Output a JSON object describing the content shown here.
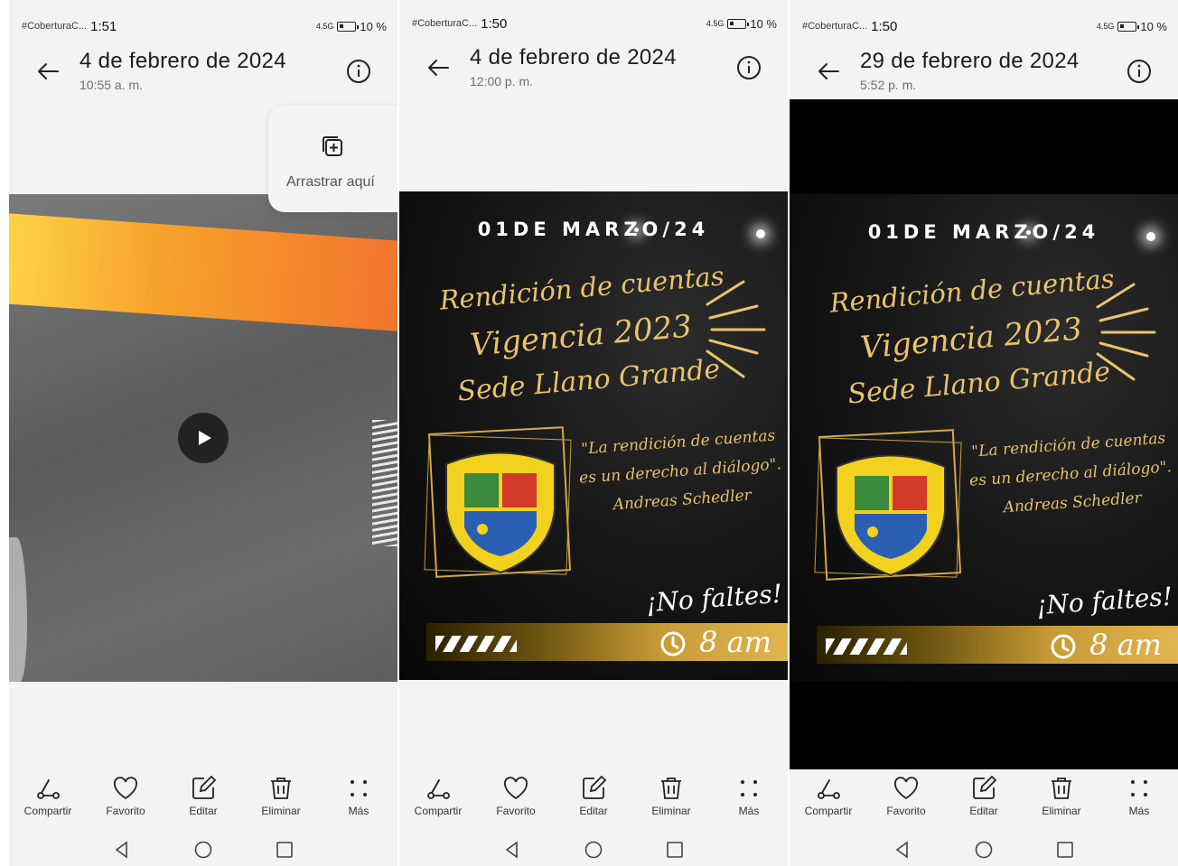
{
  "status": {
    "carrier": "#CoberturaC...",
    "times": [
      "1:51",
      "1:50",
      "1:50"
    ],
    "network": "4.5G",
    "battery": "10 %"
  },
  "screens": [
    {
      "title": "4 de febrero de 2024",
      "subtitle": "10:55 a. m."
    },
    {
      "title": "4 de febrero de 2024",
      "subtitle": "12:00 p. m."
    },
    {
      "title": "29 de febrero de 2024",
      "subtitle": "5:52 p. m."
    }
  ],
  "drop_zone": {
    "label": "Arrastrar aquí"
  },
  "poster": {
    "date": "01DE MARZO/24",
    "line1": "Rendición de cuentas",
    "line2": "Vigencia 2023",
    "line3": "Sede Llano Grande",
    "quote": "\"La rendición de cuentas es un derecho al diálogo\".",
    "author": "Andreas Schedler",
    "cta": "¡No faltes!",
    "time": "8 am",
    "gold": "#e1b54e"
  },
  "actions": {
    "share": "Compartir",
    "favorite": "Favorito",
    "edit": "Editar",
    "delete": "Eliminar",
    "more": "Más"
  },
  "icons": [
    "back-arrow-icon",
    "info-icon",
    "play-icon",
    "add-to-album-icon",
    "share-icon",
    "heart-icon",
    "edit-icon",
    "trash-icon",
    "more-icon",
    "back-triangle-icon",
    "home-circle-icon",
    "recents-square-icon"
  ]
}
